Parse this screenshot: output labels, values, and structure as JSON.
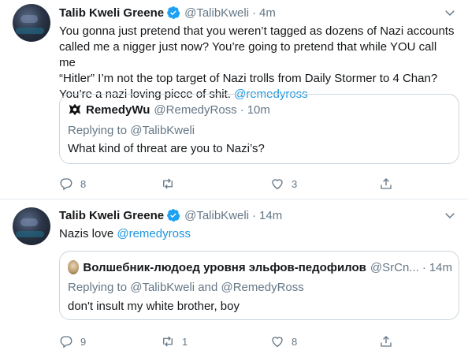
{
  "tweets": [
    {
      "author_name": "Talib Kweli Greene",
      "handle": "@TalibKweli",
      "separator": "·",
      "time": "4m",
      "text_lines": [
        "You gonna just pretend that you weren’t tagged as dozens of Nazi accounts",
        "called me a nigger just now? You’re going to pretend that while YOU call me",
        "“Hitler” I’m not the top target of Nazi trolls from Daily Stormer to 4 Chan?",
        "You’re a nazi loving piece of shit."
      ],
      "mention": "@remedyross",
      "quote": {
        "author_name": "RemedyWu",
        "handle": "@RemedyRoss",
        "separator": "·",
        "time": "10m",
        "replying": "Replying to @TalibKweli",
        "text": "What kind of threat are you to Nazi’s?"
      },
      "actions": {
        "replies": "8",
        "retweets": "",
        "likes": "3"
      }
    },
    {
      "author_name": "Talib Kweli Greene",
      "handle": "@TalibKweli",
      "separator": "·",
      "time": "14m",
      "text_prefix": "Nazis love ",
      "mention": "@remedyross",
      "quote": {
        "author_name": "Волшебник-людоед уровня эльфов-педофилов",
        "handle": "@SrCn...",
        "separator": "·",
        "time": "14m",
        "replying": "Replying to @TalibKweli and @RemedyRoss",
        "text": "don't insult my white brother, boy"
      },
      "actions": {
        "replies": "9",
        "retweets": "1",
        "likes": "8"
      }
    }
  ],
  "colors": {
    "accent": "#1da1f2",
    "link": "#1b95e0",
    "muted": "#657786",
    "border": "#ccd6dd"
  },
  "icons": [
    "verified-badge-icon",
    "chevron-down-icon",
    "reply-icon",
    "retweet-icon",
    "like-icon",
    "share-icon"
  ]
}
